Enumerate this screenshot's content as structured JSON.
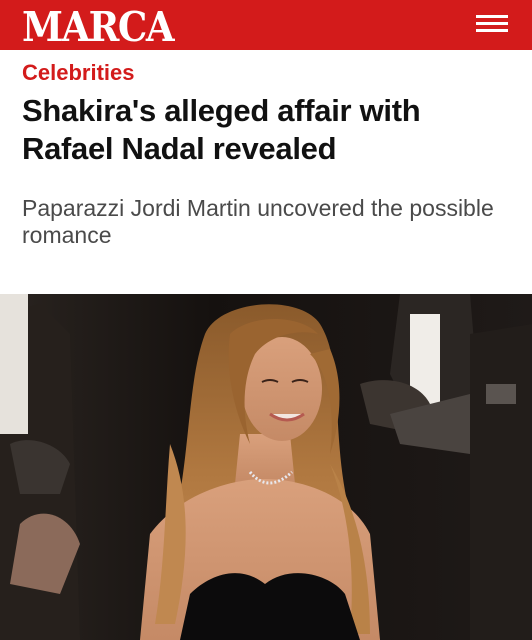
{
  "header": {
    "logo_text": "MARCA",
    "brand_color": "#d31b1b"
  },
  "article": {
    "category": "Celebrities",
    "headline": "Shakira's alleged affair with Rafael Nadal revealed",
    "subtitle": "Paparazzi Jordi Martin uncovered the possible romance"
  },
  "icons": {
    "menu": "hamburger-menu-icon"
  },
  "image": {
    "subject": "Woman with long wavy auburn hair in black strapless dress and diamond necklace, photographers in background"
  }
}
